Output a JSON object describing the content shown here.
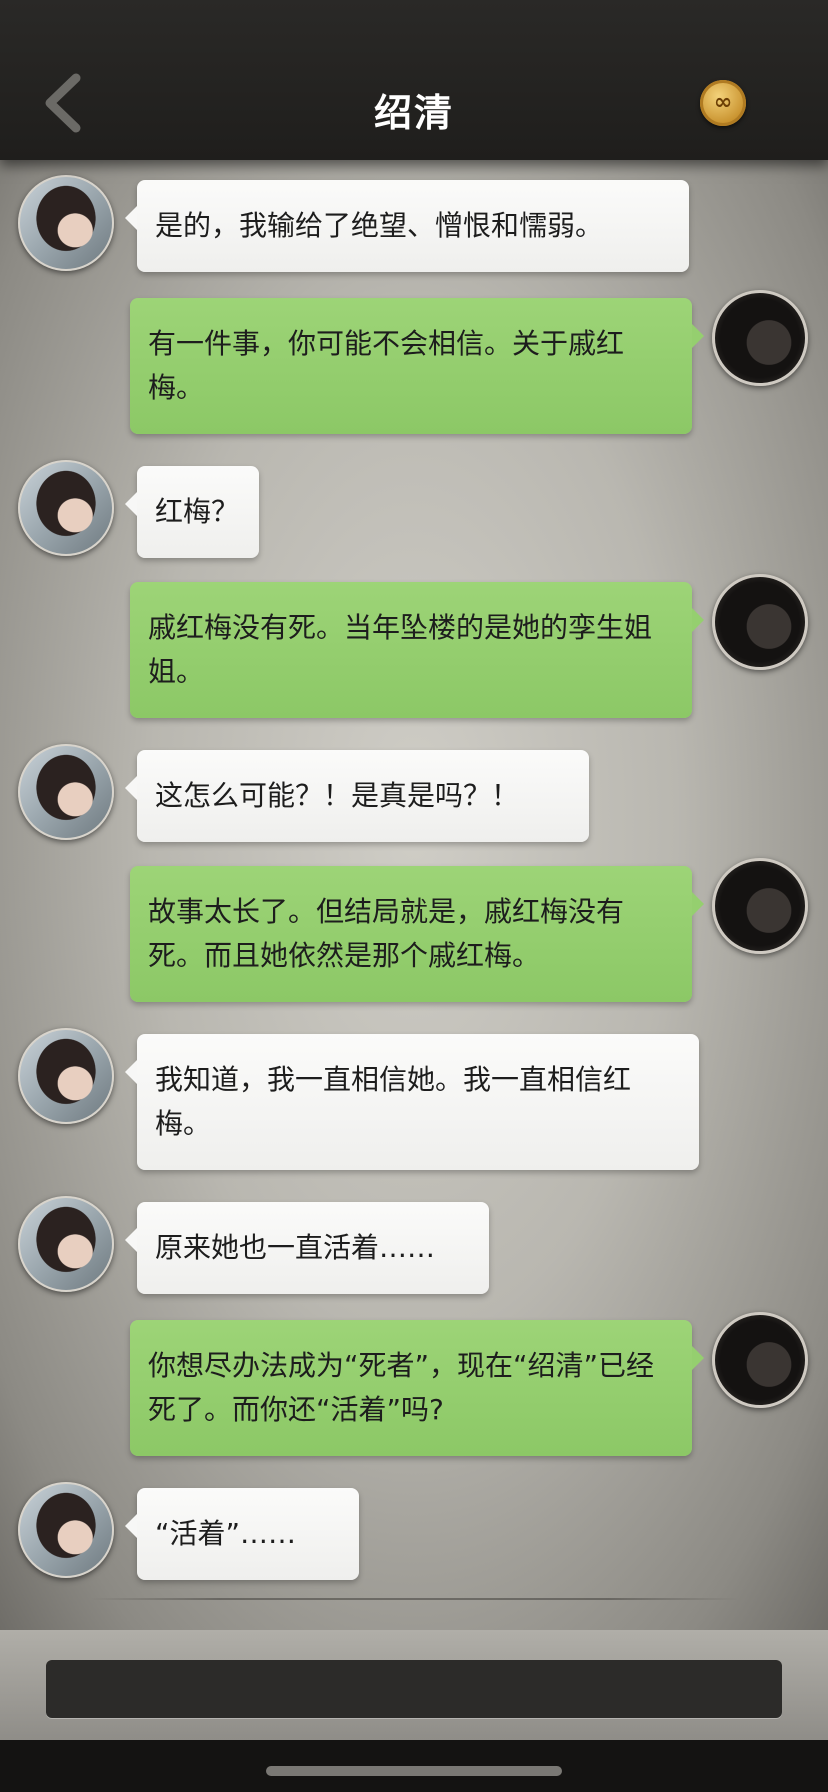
{
  "header": {
    "title": "绍清",
    "coin_icon": "coin-icon",
    "back_icon": "chevron-left-icon"
  },
  "messages": [
    {
      "from": "her",
      "text": "是的，我输给了绝望、憎恨和懦弱。"
    },
    {
      "from": "me",
      "text": "有一件事，你可能不会相信。关于戚红梅。"
    },
    {
      "from": "her",
      "text": "红梅？"
    },
    {
      "from": "me",
      "text": "戚红梅没有死。当年坠楼的是她的孪生姐姐。"
    },
    {
      "from": "her",
      "text": "这怎么可能？！是真是吗？！"
    },
    {
      "from": "me",
      "text": "故事太长了。但结局就是，戚红梅没有死。而且她依然是那个戚红梅。"
    },
    {
      "from": "her",
      "text": "我知道，我一直相信她。我一直相信红梅。"
    },
    {
      "from": "her",
      "text": "原来她也一直活着……"
    },
    {
      "from": "me",
      "text": "你想尽办法成为“死者”，现在“绍清”已经死了。而你还“活着”吗?"
    },
    {
      "from": "her",
      "text": "“活着”……"
    }
  ],
  "colors": {
    "her_bubble": "#f7f7f6",
    "me_bubble": "#95cf6f",
    "header_bg": "#232220",
    "coin": "#d9a540"
  }
}
